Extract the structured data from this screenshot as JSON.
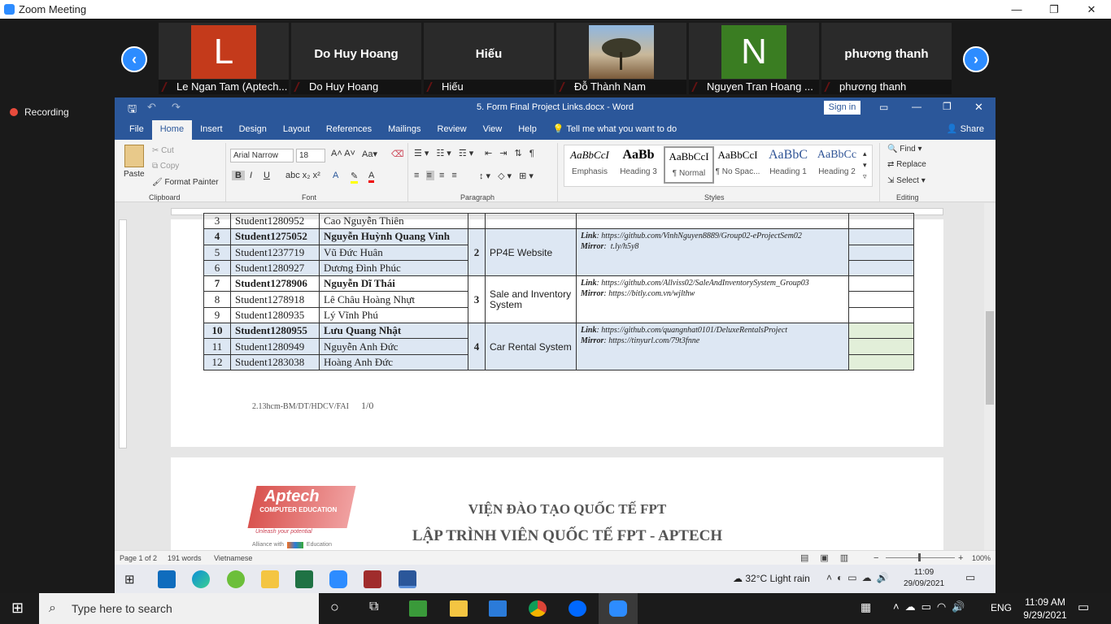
{
  "zoom": {
    "title": "Zoom Meeting",
    "recording": "Recording",
    "participants": [
      {
        "name": "Le Ngan Tam (Aptech...",
        "avatar": "L",
        "color": "#c43a1b"
      },
      {
        "name": "Do Huy Hoang",
        "display": "Do Huy Hoang"
      },
      {
        "name": "Hiếu",
        "display": "Hiếu"
      },
      {
        "name": "Đỗ Thành Nam",
        "photo": true
      },
      {
        "name": "Nguyen Tran Hoang ...",
        "avatar": "N",
        "color": "#3a7d22"
      },
      {
        "name": "phương thanh",
        "display": "phương thanh"
      }
    ]
  },
  "word": {
    "doc_title": "5. Form Final Project Links.docx  -  Word",
    "sign_in": "Sign in",
    "tabs": [
      "File",
      "Home",
      "Insert",
      "Design",
      "Layout",
      "References",
      "Mailings",
      "Review",
      "View",
      "Help"
    ],
    "tell_me": "Tell me what you want to do",
    "share": "Share",
    "clipboard": {
      "paste": "Paste",
      "cut": "Cut",
      "copy": "Copy",
      "format_painter": "Format Painter",
      "label": "Clipboard"
    },
    "font": {
      "family": "Arial Narrow",
      "size": "18",
      "label": "Font"
    },
    "paragraph_label": "Paragraph",
    "styles": [
      {
        "preview": "AaBbCcI",
        "name": "Emphasis"
      },
      {
        "preview": "AaBb",
        "name": "Heading 3"
      },
      {
        "preview": "AaBbCcI",
        "name": "¶ Normal"
      },
      {
        "preview": "AaBbCcI",
        "name": "¶ No Spac..."
      },
      {
        "preview": "AaBbC",
        "name": "Heading 1"
      },
      {
        "preview": "AaBbCc",
        "name": "Heading 2"
      }
    ],
    "styles_label": "Styles",
    "editing": {
      "find": "Find",
      "replace": "Replace",
      "select": "Select",
      "label": "Editing"
    },
    "table": {
      "top_partial": {
        "no": "3",
        "id": "Student1280952",
        "name": "Cao Nguyễn Thiên"
      },
      "groups": [
        {
          "group": "2",
          "project": "PP4E Website",
          "link": "https://github.com/VinhNguyen8889/Group02-eProjectSem02",
          "mirror": "t.ly/h5y8",
          "rows": [
            {
              "no": "4",
              "id": "Student1275052",
              "name": "Nguyễn Huỳnh Quang Vinh",
              "leader": true
            },
            {
              "no": "5",
              "id": "Student1237719",
              "name": "Vũ Đức Huân"
            },
            {
              "no": "6",
              "id": "Student1280927",
              "name": "Dương Đình Phúc"
            }
          ]
        },
        {
          "group": "3",
          "project": "Sale and Inventory System",
          "link": "https://github.com/Allviss02/SaleAndInventorySystem_Group03",
          "mirror": "https://bitly.com.vn/wjlthw",
          "rows": [
            {
              "no": "7",
              "id": "Student1278906",
              "name": "Nguyễn Dĩ Thái",
              "leader": true
            },
            {
              "no": "8",
              "id": "Student1278918",
              "name": "Lê Châu Hoàng Nhựt"
            },
            {
              "no": "9",
              "id": "Student1280935",
              "name": "Lý Vĩnh Phú"
            }
          ]
        },
        {
          "group": "4",
          "project": "Car Rental System",
          "link": "https://github.com/quangnhat0101/DeluxeRentalsProject",
          "mirror": "https://tinyurl.com/79t3fnne",
          "rows": [
            {
              "no": "10",
              "id": "Student1280955",
              "name": "Lưu Quang Nhật",
              "leader": true
            },
            {
              "no": "11",
              "id": "Student1280949",
              "name": "Nguyễn Anh Đức"
            },
            {
              "no": "12",
              "id": "Student1283038",
              "name": "Hoàng Anh Đức"
            }
          ]
        }
      ],
      "link_label": "Link",
      "mirror_label": "Mirror"
    },
    "footer_code": "2.13hcm-BM/DT/HDCV/FAI",
    "footer_ver": "1/0",
    "page2": {
      "logo_text": "Aptech",
      "logo_sub": "COMPUTER EDUCATION",
      "logo_tag": "Unleash your potential",
      "logo_alliance": "Alliance with",
      "logo_edu": "Education",
      "line1": "VIỆN ĐÀO TẠO QUỐC TẾ FPT",
      "line2": "LẬP TRÌNH VIÊN QUỐC TẾ FPT - APTECH"
    },
    "status": {
      "page": "Page 1 of 2",
      "words": "191 words",
      "lang": "Vietnamese",
      "zoom": "100%"
    }
  },
  "remote_taskbar": {
    "weather": "32°C  Light rain",
    "time": "11:09",
    "date": "29/09/2021"
  },
  "taskbar": {
    "search": "Type here to search",
    "lang": "ENG",
    "time": "11:09 AM",
    "date": "9/29/2021"
  }
}
